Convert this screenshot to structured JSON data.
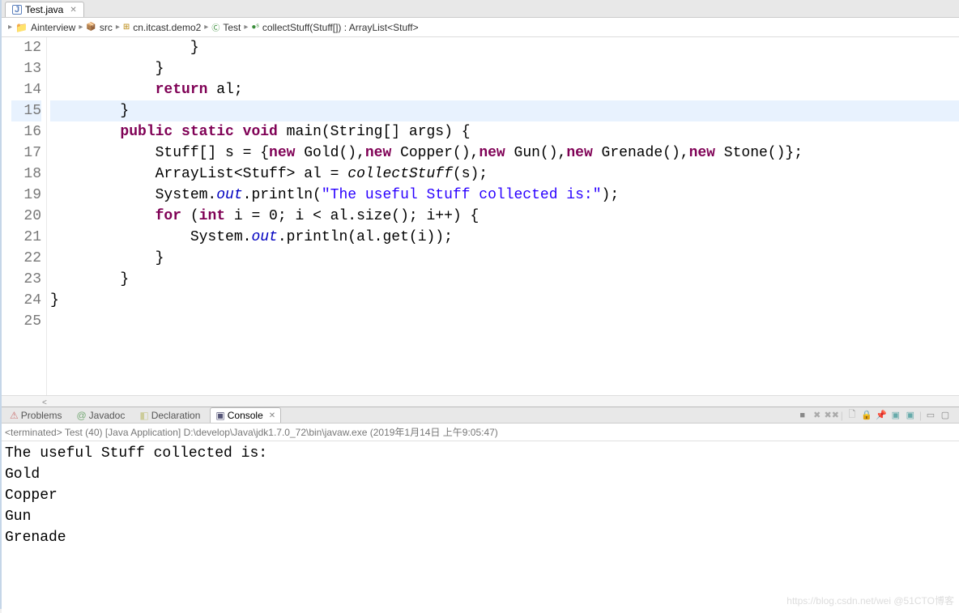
{
  "tab": {
    "title": "Test.java",
    "close_glyph": "✕"
  },
  "breadcrumb": {
    "items": [
      "Ainterview",
      "src",
      "cn.itcast.demo2",
      "Test",
      "collectStuff(Stuff[]) : ArrayList<Stuff>"
    ]
  },
  "code": {
    "first_line": 12,
    "lines": [
      {
        "n": 12,
        "pre": "                ",
        "raw": "}"
      },
      {
        "n": 13,
        "pre": "            ",
        "raw": "}"
      },
      {
        "n": 14,
        "pre": "            ",
        "kw": "return",
        "rest": " al;"
      },
      {
        "n": 15,
        "pre": "        ",
        "raw": "}",
        "hl": true
      },
      {
        "n": 16,
        "pre": "        ",
        "html": "<span class=\"kw\">public static void</span> main(String[] args) {"
      },
      {
        "n": 17,
        "pre": "            ",
        "html": "Stuff[] s = {<span class=\"kw\">new</span> Gold(),<span class=\"kw\">new</span> Copper(),<span class=\"kw\">new</span> Gun(),<span class=\"kw\">new</span> Grenade(),<span class=\"kw\">new</span> Stone()};"
      },
      {
        "n": 18,
        "pre": "            ",
        "html": "ArrayList&lt;Stuff&gt; al = <span class=\"fnci\">collectStuff</span>(s);"
      },
      {
        "n": 19,
        "pre": "            ",
        "html": "System.<span class=\"fld\">out</span>.println(<span class=\"st\">\"The useful Stuff collected is:\"</span>);"
      },
      {
        "n": 20,
        "pre": "            ",
        "html": "<span class=\"kw\">for</span> (<span class=\"kw\">int</span> i = 0; i &lt; al.size(); i++) {"
      },
      {
        "n": 21,
        "pre": "                ",
        "html": "System.<span class=\"fld\">out</span>.println(al.get(i));"
      },
      {
        "n": 22,
        "pre": "            ",
        "raw": "}"
      },
      {
        "n": 23,
        "pre": "        ",
        "raw": "}"
      },
      {
        "n": 24,
        "pre": "",
        "raw": "}"
      },
      {
        "n": 25,
        "pre": "",
        "raw": ""
      }
    ]
  },
  "views": {
    "tabs": [
      "Problems",
      "Javadoc",
      "Declaration",
      "Console"
    ],
    "active": 3
  },
  "console": {
    "header": "<terminated> Test (40) [Java Application] D:\\develop\\Java\\jdk1.7.0_72\\bin\\javaw.exe (2019年1月14日 上午9:05:47)",
    "lines": [
      "The useful Stuff collected is:",
      "Gold",
      "Copper",
      "Gun",
      "Grenade"
    ]
  },
  "watermark": "https://blog.csdn.net/wei @51CTO博客",
  "toolbar_icons": [
    "stop",
    "clear",
    "clear-all",
    "pin",
    "scroll-lock",
    "sel-console",
    "open-console",
    "display",
    "wrap",
    "min",
    "max"
  ]
}
